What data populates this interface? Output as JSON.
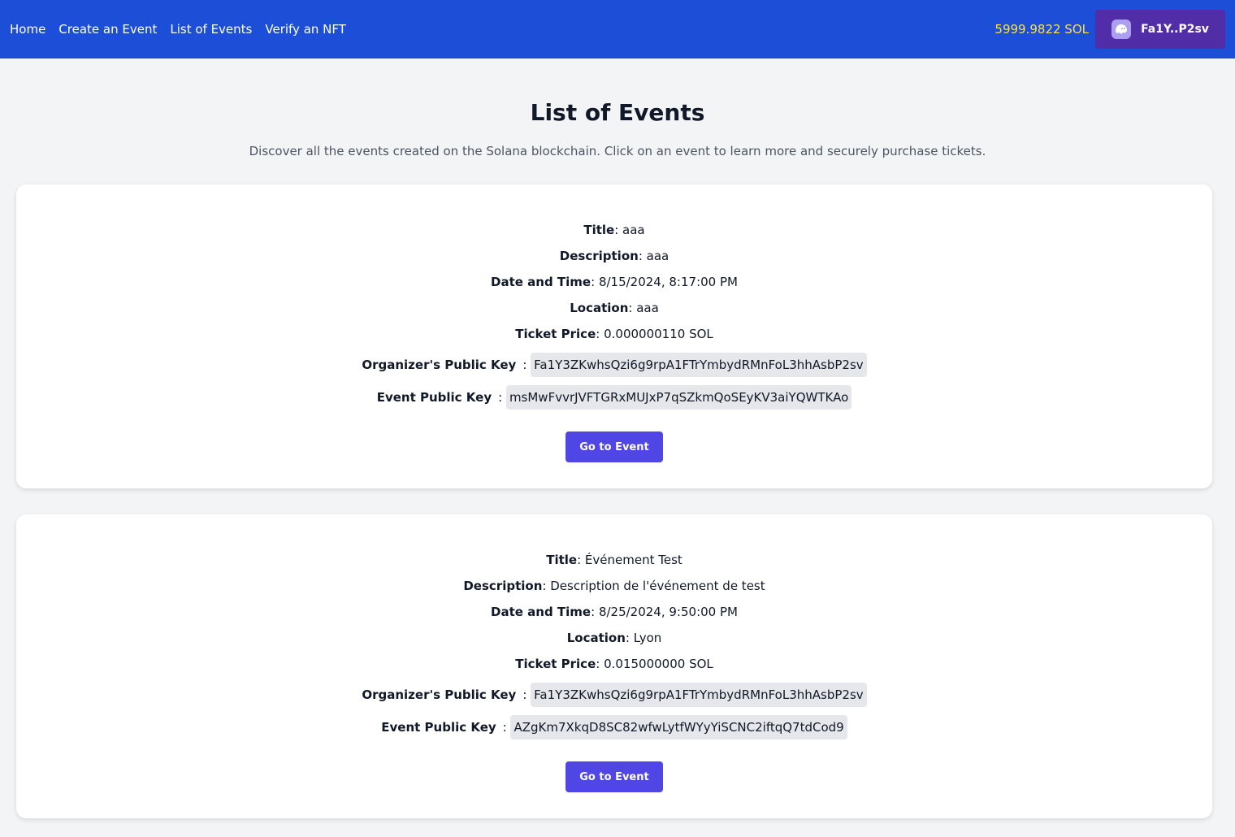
{
  "nav": {
    "links": [
      "Home",
      "Create an Event",
      "List of Events",
      "Verify an NFT"
    ],
    "balance": "5999.9822 SOL",
    "wallet_label": "Fa1Y..P2sv"
  },
  "header": {
    "title": "List of Events",
    "subtitle": "Discover all the events created on the Solana blockchain. Click on an event to learn more and securely purchase tickets."
  },
  "labels": {
    "title": "Title",
    "description": "Description",
    "date": "Date and Time",
    "location": "Location",
    "price": "Ticket Price",
    "organizer": "Organizer's Public Key",
    "event_key": "Event Public Key",
    "button": "Go to Event"
  },
  "events": [
    {
      "title": "aaa",
      "description": "aaa",
      "date": "8/15/2024, 8:17:00 PM",
      "location": "aaa",
      "price": "0.000000110 SOL",
      "organizer": "Fa1Y3ZKwhsQzi6g9rpA1FTrYmbydRMnFoL3hhAsbP2sv",
      "event_key": "msMwFvvrJVFTGRxMUJxP7qSZkmQoSEyKV3aiYQWTKAo"
    },
    {
      "title": "Événement Test",
      "description": "Description de l'événement de test",
      "date": "8/25/2024, 9:50:00 PM",
      "location": "Lyon",
      "price": "0.015000000 SOL",
      "organizer": "Fa1Y3ZKwhsQzi6g9rpA1FTrYmbydRMnFoL3hhAsbP2sv",
      "event_key": "AZgKm7XkqD8SC82wfwLytfWYyYiSCNC2iftqQ7tdCod9"
    }
  ]
}
